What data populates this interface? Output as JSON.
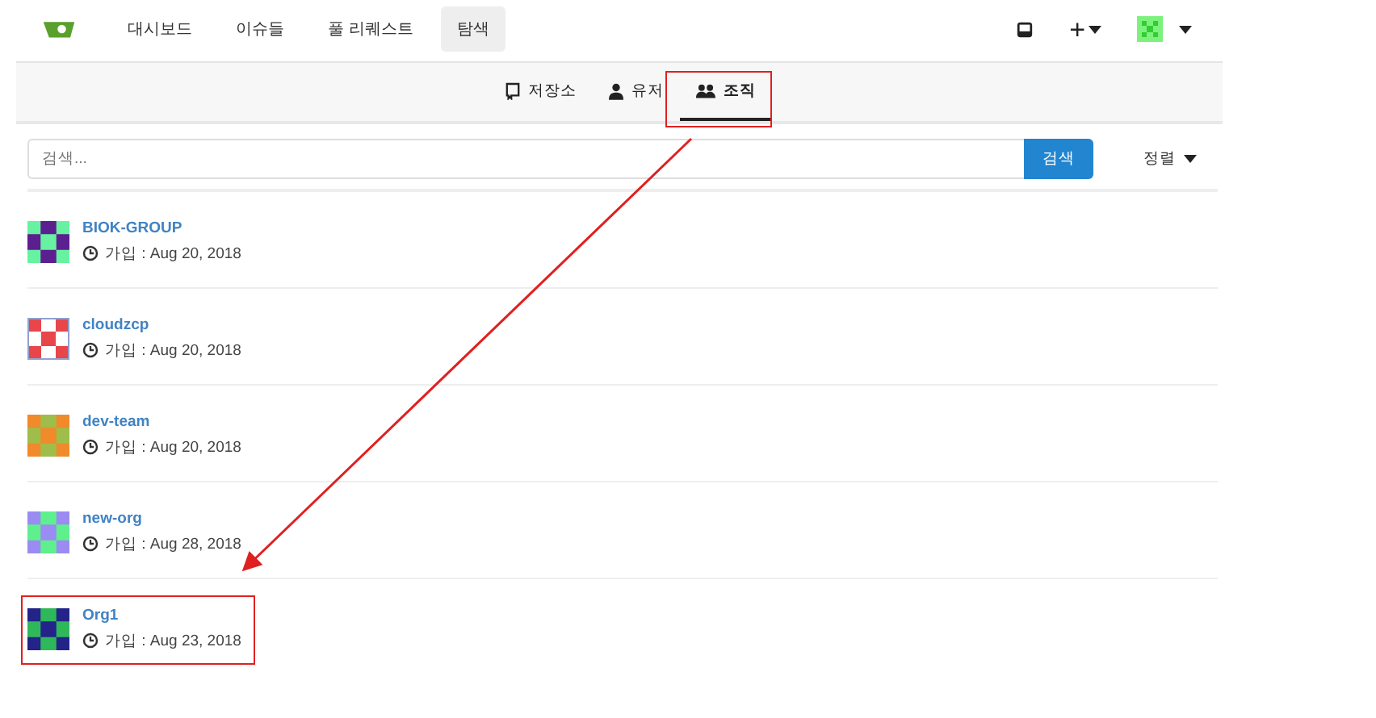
{
  "navbar": {
    "items": [
      {
        "label": "대시보드",
        "selected": false
      },
      {
        "label": "이슈들",
        "selected": false
      },
      {
        "label": "풀 리퀘스트",
        "selected": false
      },
      {
        "label": "탐색",
        "selected": true
      }
    ]
  },
  "new_menu": {
    "label": "+"
  },
  "explore_tabs": [
    {
      "label": "저장소",
      "selected": false
    },
    {
      "label": "유저",
      "selected": false
    },
    {
      "label": "조직",
      "selected": true
    }
  ],
  "search": {
    "placeholder": "검색...",
    "button": "검색",
    "sort": "정렬"
  },
  "organizations": [
    {
      "name": "BIOK-GROUP",
      "joined": "가입 : Aug 20, 2018"
    },
    {
      "name": "cloudzcp",
      "joined": "가입 : Aug 20, 2018"
    },
    {
      "name": "dev-team",
      "joined": "가입 : Aug 20, 2018"
    },
    {
      "name": "new-org",
      "joined": "가입 : Aug 28, 2018"
    },
    {
      "name": "Org1",
      "joined": "가입 : Aug 23, 2018"
    }
  ]
}
